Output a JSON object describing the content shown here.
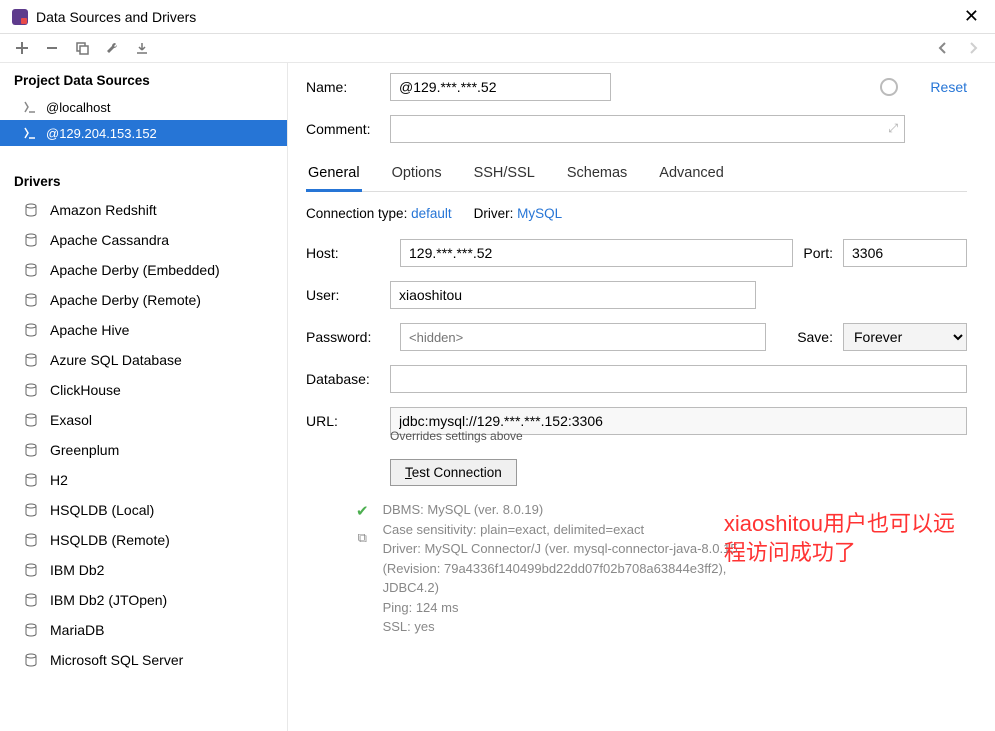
{
  "window": {
    "title": "Data Sources and Drivers"
  },
  "sidebar": {
    "projectHeader": "Project Data Sources",
    "dataSources": [
      {
        "label": "@localhost",
        "selected": false
      },
      {
        "label": "@129.204.153.152",
        "selected": true
      }
    ],
    "driversHeader": "Drivers",
    "drivers": [
      "Amazon Redshift",
      "Apache Cassandra",
      "Apache Derby (Embedded)",
      "Apache Derby (Remote)",
      "Apache Hive",
      "Azure SQL Database",
      "ClickHouse",
      "Exasol",
      "Greenplum",
      "H2",
      "HSQLDB (Local)",
      "HSQLDB (Remote)",
      "IBM Db2",
      "IBM Db2 (JTOpen)",
      "MariaDB",
      "Microsoft SQL Server"
    ]
  },
  "form": {
    "nameLabel": "Name:",
    "nameValue": "@129.***.***.52",
    "resetLabel": "Reset",
    "commentLabel": "Comment:",
    "tabs": [
      "General",
      "Options",
      "SSH/SSL",
      "Schemas",
      "Advanced"
    ],
    "activeTab": "General",
    "connTypeLabel": "Connection type:",
    "connTypeValue": "default",
    "driverLabel": "Driver:",
    "driverValue": "MySQL",
    "hostLabel": "Host:",
    "hostValue": "129.***.***.52",
    "portLabel": "Port:",
    "portValue": "3306",
    "userLabel": "User:",
    "userValue": "xiaoshitou",
    "passwordLabel": "Password:",
    "passwordPlaceholder": "<hidden>",
    "saveLabel": "Save:",
    "saveValue": "Forever",
    "databaseLabel": "Database:",
    "databaseValue": "",
    "urlLabel": "URL:",
    "urlValue": "jdbc:mysql://129.***.***.152:3306",
    "overrideNote": "Overrides settings above",
    "testBtnPrefix": "T",
    "testBtnRest": "est Connection",
    "result": {
      "dbms": "DBMS: MySQL (ver. 8.0.19)",
      "caseSens": "Case sensitivity: plain=exact, delimited=exact",
      "driver": "Driver: MySQL Connector/J (ver. mysql-connector-java-8.0.15 (Revision: 79a4336f140499bd22dd07f02b708a63844e3ff2), JDBC4.2)",
      "ping": "Ping: 124 ms",
      "ssl": "SSL: yes"
    }
  },
  "annotation": {
    "line1": "xiaoshitou用户也可以远",
    "line2": "程访问成功了"
  }
}
